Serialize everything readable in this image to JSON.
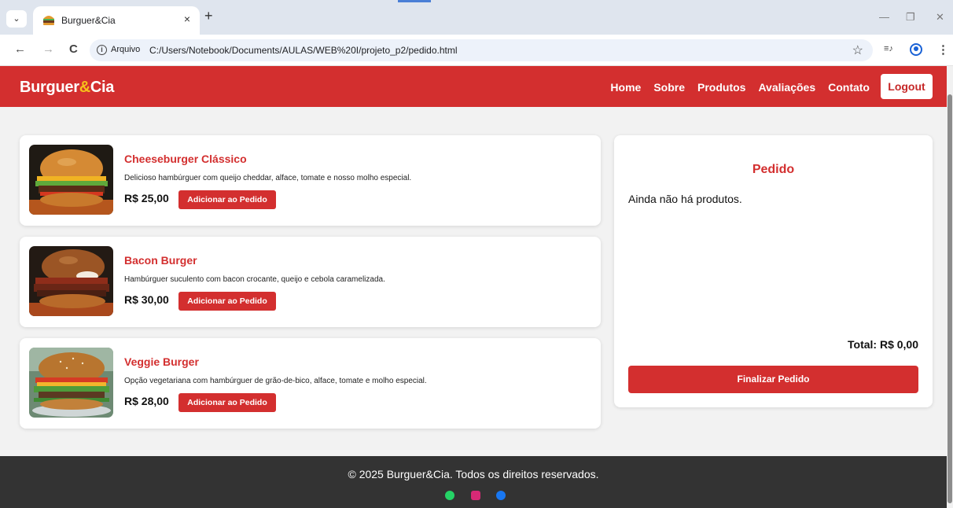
{
  "browser": {
    "tab_title": "Burguer&Cia",
    "tab_close": "×",
    "new_tab": "+",
    "menu_chevron": "⌄",
    "win_minimize": "—",
    "win_restore": "❐",
    "win_close": "✕",
    "back": "←",
    "forward": "→",
    "reload": "C",
    "info": "i",
    "file_label": "Arquivo",
    "url": "C:/Users/Notebook/Documents/AULAS/WEB%20I/projeto_p2/pedido.html",
    "star": "☆",
    "media_icon": "≡♪",
    "kebab": "⋮"
  },
  "site": {
    "brand_part1": "Burguer",
    "brand_amp": "&",
    "brand_part2": "Cia",
    "nav": [
      "Home",
      "Sobre",
      "Produtos",
      "Avaliações",
      "Contato"
    ],
    "logout": "Logout",
    "colors": {
      "primary": "#d32f2f",
      "accent": "#f6c21a",
      "footer": "#333333"
    }
  },
  "products": [
    {
      "name": "Cheeseburger Clássico",
      "description": "Delicioso hambúrguer com queijo cheddar, alface, tomate e nosso molho especial.",
      "price": "R$ 25,00",
      "button": "Adicionar ao Pedido"
    },
    {
      "name": "Bacon Burger",
      "description": "Hambúrguer suculento com bacon crocante, queijo e cebola caramelizada.",
      "price": "R$ 30,00",
      "button": "Adicionar ao Pedido"
    },
    {
      "name": "Veggie Burger",
      "description": "Opção vegetariana com hambúrguer de grão-de-bico, alface, tomate e molho especial.",
      "price": "R$ 28,00",
      "button": "Adicionar ao Pedido"
    }
  ],
  "order": {
    "title": "Pedido",
    "empty_message": "Ainda não há produtos.",
    "total": "Total: R$ 0,00",
    "finish_button": "Finalizar Pedido"
  },
  "footer": {
    "copyright": "© 2025 Burguer&Cia. Todos os direitos reservados.",
    "social_icons": [
      "whatsapp-icon",
      "instagram-icon",
      "facebook-icon"
    ]
  }
}
